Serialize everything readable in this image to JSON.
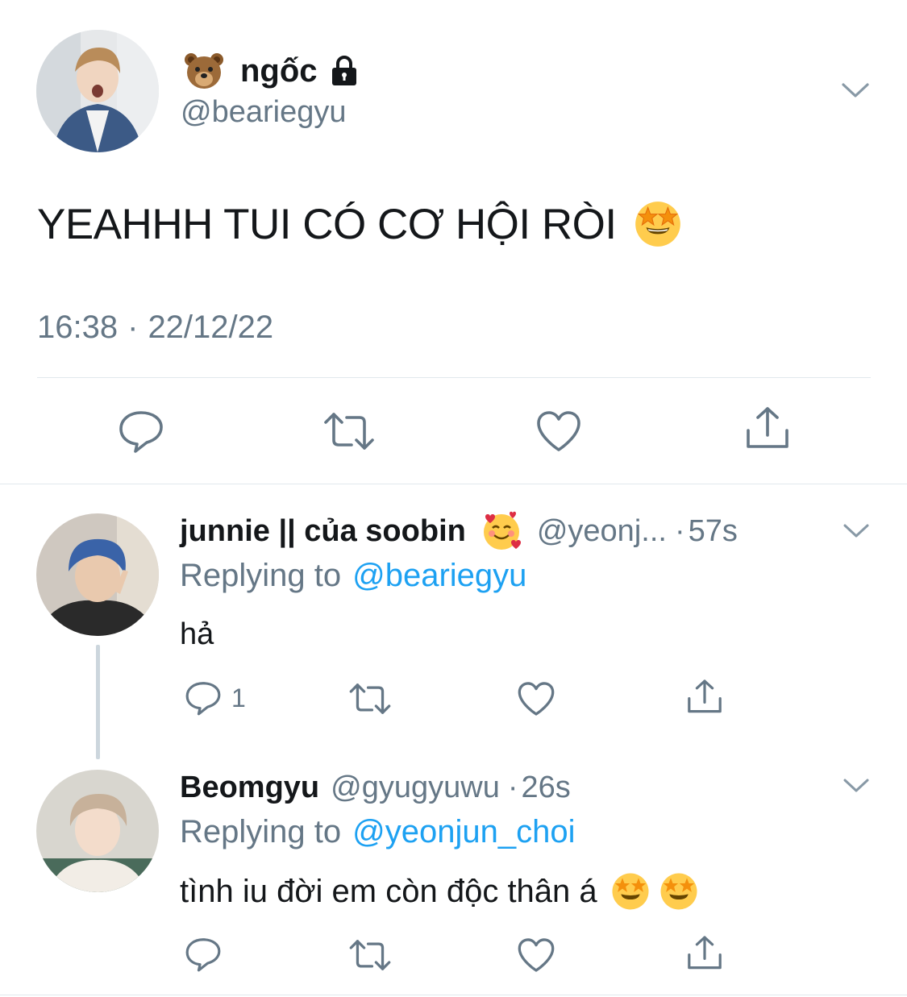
{
  "main_tweet": {
    "avatar": "avatar-photo",
    "display_name": "ngốc",
    "name_emoji": "bear-face-emoji",
    "lock_icon": "lock-icon",
    "handle": "@beariegyu",
    "text": "YEAHHH TUI CÓ CƠ HỘI RÒI",
    "text_emoji": "star-struck-emoji",
    "time": "16:38",
    "separator": "·",
    "date": "22/12/22",
    "menu_icon": "chevron-down-icon",
    "actions": [
      "reply-icon",
      "retweet-icon",
      "like-icon",
      "share-icon"
    ]
  },
  "replies": [
    {
      "avatar": "avatar-photo",
      "display_name": "junnie || của soobin",
      "name_emoji": "smiling-face-with-hearts-emoji",
      "handle": "@yeonj...",
      "separator": "·",
      "time": "57s",
      "replying_prefix": "Replying to",
      "replying_to": "@beariegyu",
      "text": "hả",
      "reply_count": "1",
      "actions": [
        "reply-icon",
        "retweet-icon",
        "like-icon",
        "share-icon"
      ]
    },
    {
      "avatar": "avatar-photo",
      "display_name": "Beomgyu",
      "handle": "@gyugyuwu",
      "separator": "·",
      "time": "26s",
      "replying_prefix": "Replying to",
      "replying_to": "@yeonjun_choi",
      "text": "tình iu đời em còn độc thân á",
      "text_emoji": "star-struck-emoji",
      "actions": [
        "reply-icon",
        "retweet-icon",
        "like-icon",
        "share-icon"
      ]
    }
  ],
  "colors": {
    "text": "#14171a",
    "secondary": "#657786",
    "link": "#1da1f2",
    "divider": "#e1e8ed",
    "thread_line": "#ccd6dd",
    "emoji_yellow": "#ffcc4d"
  }
}
